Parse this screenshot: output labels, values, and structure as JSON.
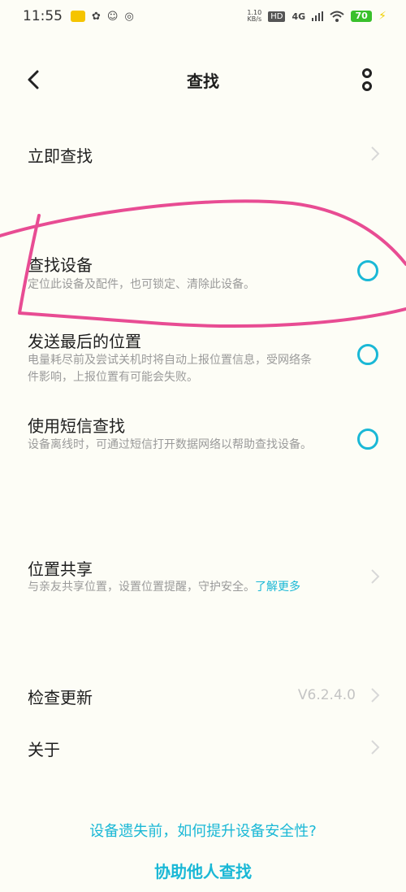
{
  "status_bar": {
    "time": "11:55",
    "net_speed_value": "1.10",
    "net_speed_unit": "KB/s",
    "hd": "HD",
    "network": "4G",
    "battery": "70"
  },
  "header": {
    "title": "查找"
  },
  "items": {
    "find_now": {
      "title": "立即查找"
    },
    "find_device": {
      "title": "查找设备",
      "desc": "定位此设备及配件，也可锁定、清除此设备。"
    },
    "send_last_location": {
      "title": "发送最后的位置",
      "desc": "电量耗尽前及尝试关机时将自动上报位置信息，受网络条件影响，上报位置有可能会失败。"
    },
    "sms_find": {
      "title": "使用短信查找",
      "desc": "设备离线时，可通过短信打开数据网络以帮助查找设备。"
    },
    "location_share": {
      "title": "位置共享",
      "desc": "与亲友共享位置，设置位置提醒，守护安全。",
      "link": "了解更多"
    },
    "check_update": {
      "title": "检查更新",
      "version": "V6.2.4.0"
    },
    "about": {
      "title": "关于"
    }
  },
  "footer": {
    "safety_tip": "设备遗失前，如何提升设备安全性?",
    "help_others": "协助他人查找"
  },
  "colors": {
    "accent": "#1AB8D6",
    "annotation": "#E84C93",
    "background": "#FDFDF6"
  }
}
